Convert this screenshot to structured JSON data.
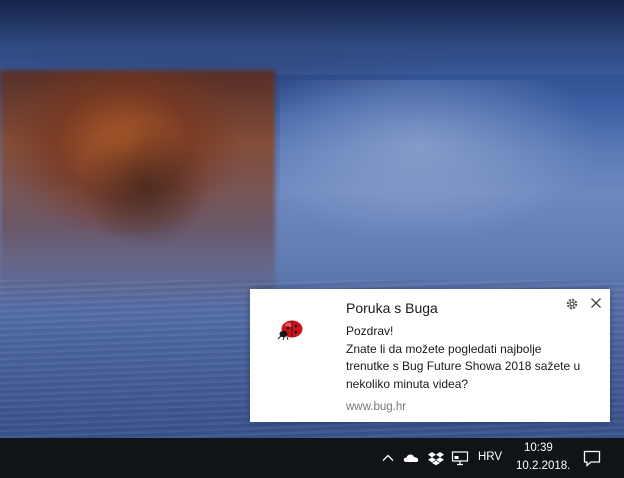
{
  "notification": {
    "title": "Poruka s Buga",
    "body_lines": [
      "Pozdrav!",
      "Znate li da možete pogledati najbolje",
      "trenutke s Bug Future Showa 2018 sažete u",
      "nekoliko minuta videa?"
    ],
    "attribution": "www.bug.hr",
    "app_icon": "ladybug-icon",
    "settings_icon": "gear-icon",
    "close_icon": "close-icon"
  },
  "taskbar": {
    "tray_icons": [
      "chevron-up-icon",
      "onedrive-cloud-icon",
      "dropbox-icon",
      "network-icon"
    ],
    "language": "HRV",
    "time": "10:39",
    "date": "10.2.2018.",
    "action_center_icon": "action-center-icon"
  },
  "colors": {
    "toast_background": "#ffffff",
    "taskbar_background": "#101418",
    "ladybug_red": "#c8141a"
  }
}
